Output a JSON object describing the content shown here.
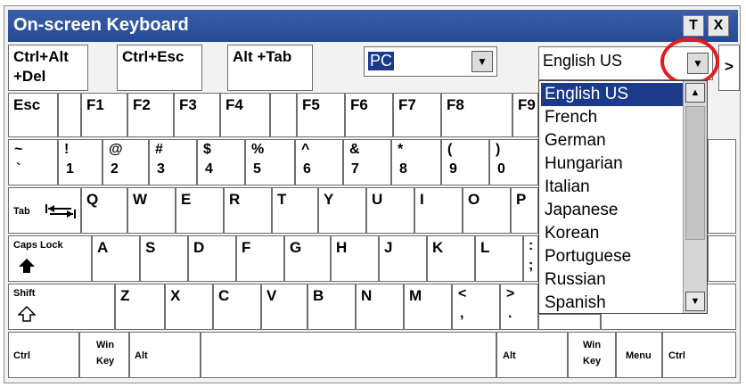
{
  "window": {
    "title": "On-screen Keyboard",
    "btn_topmost": "T",
    "btn_close": "X"
  },
  "top": {
    "ctrl_alt_del_1": "Ctrl+Alt",
    "ctrl_alt_del_2": "+Del",
    "ctrl_esc": "Ctrl+Esc",
    "alt_tab": "Alt +Tab",
    "layout_value": "PC",
    "language_value": "English US",
    "more_arrow": ">"
  },
  "fn": {
    "esc": "Esc",
    "f1": "F1",
    "f2": "F2",
    "f3": "F3",
    "f4": "F4",
    "f5": "F5",
    "f6": "F6",
    "f7": "F7",
    "f8": "F8",
    "f9": "F9"
  },
  "num": [
    {
      "up": "~",
      "lo": "`"
    },
    {
      "up": "!",
      "lo": "1"
    },
    {
      "up": "@",
      "lo": "2"
    },
    {
      "up": "#",
      "lo": "3"
    },
    {
      "up": "$",
      "lo": "4"
    },
    {
      "up": "%",
      "lo": "5"
    },
    {
      "up": "^",
      "lo": "6"
    },
    {
      "up": "&",
      "lo": "7"
    },
    {
      "up": "*",
      "lo": "8"
    },
    {
      "up": "(",
      "lo": "9"
    },
    {
      "up": ")",
      "lo": "0"
    }
  ],
  "qrow": {
    "tab": "Tab",
    "keys": [
      "Q",
      "W",
      "E",
      "R",
      "T",
      "Y",
      "U",
      "I",
      "O",
      "P"
    ]
  },
  "arow": {
    "caps": "Caps Lock",
    "keys": [
      "A",
      "S",
      "D",
      "F",
      "G",
      "H",
      "J",
      "K",
      "L"
    ],
    "semi_up": ":",
    "semi_lo": ";"
  },
  "zrow": {
    "shift": "Shift",
    "keys": [
      "Z",
      "X",
      "C",
      "V",
      "B",
      "N",
      "M"
    ],
    "comma_up": "<",
    "comma_lo": ",",
    "period_up": ">",
    "period_lo": "."
  },
  "bottom": {
    "ctrl_l": "Ctrl",
    "win_l_1": "Win",
    "win_l_2": "Key",
    "alt_l": "Alt",
    "alt_r": "Alt",
    "win_r_1": "Win",
    "win_r_2": "Key",
    "menu": "Menu",
    "ctrl_r": "Ctrl"
  },
  "languages": {
    "items": [
      "English US",
      "French",
      "German",
      "Hungarian",
      "Italian",
      "Japanese",
      "Korean",
      "Portuguese",
      "Russian",
      "Spanish"
    ],
    "selected_index": 0
  },
  "colors": {
    "title_bar": "#2b4f9c",
    "selection": "#1c3a8a",
    "highlight_ring": "#e21c1c"
  }
}
